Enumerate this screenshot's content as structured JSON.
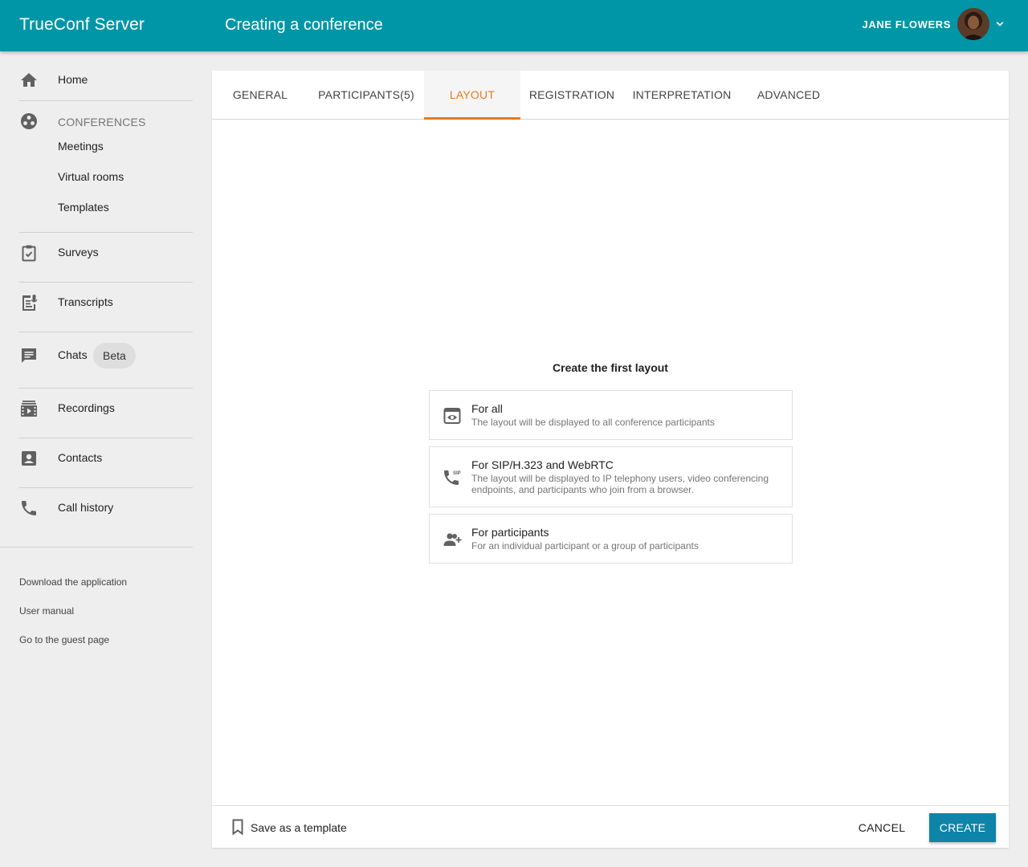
{
  "header": {
    "brand": "TrueConf Server",
    "title": "Creating a conference",
    "user_name": "JANE FLOWERS",
    "avatar_icon": "user-avatar",
    "menu_icon": "chevron-down-icon"
  },
  "sidebar": {
    "home": {
      "label": "Home",
      "icon": "home-icon"
    },
    "conferences": {
      "title": "CONFERENCES",
      "icon": "conferences-icon",
      "items": [
        "Meetings",
        "Virtual rooms",
        "Templates"
      ]
    },
    "surveys": {
      "label": "Surveys",
      "icon": "clipboard-check-icon"
    },
    "transcripts": {
      "label": "Transcripts",
      "icon": "transcript-icon"
    },
    "chats": {
      "label": "Chats",
      "badge": "Beta",
      "icon": "chat-icon"
    },
    "recordings": {
      "label": "Recordings",
      "icon": "recordings-icon"
    },
    "contacts": {
      "label": "Contacts",
      "icon": "contact-icon"
    },
    "call_history": {
      "label": "Call history",
      "icon": "phone-icon"
    },
    "footer_links": [
      "Download the application",
      "User manual",
      "Go to the guest page"
    ]
  },
  "tabs": [
    {
      "label": "GENERAL",
      "active": false
    },
    {
      "label": "PARTICIPANTS(5)",
      "active": false
    },
    {
      "label": "LAYOUT",
      "active": true
    },
    {
      "label": "REGISTRATION",
      "active": false
    },
    {
      "label": "INTERPRETATION",
      "active": false
    },
    {
      "label": "ADVANCED",
      "active": false
    }
  ],
  "layout": {
    "empty_title": "Create the first layout",
    "options": [
      {
        "title": "For all",
        "description": "The layout will be displayed to all conference participants",
        "icon": "eye-window-icon"
      },
      {
        "title": "For SIP/H.323 and WebRTC",
        "description": "The layout will be displayed to IP telephony users, video conferencing endpoints, and participants who join from a browser.",
        "icon": "sip-phone-icon"
      },
      {
        "title": "For participants",
        "description": "For an individual participant or a group of participants",
        "icon": "add-participants-icon"
      }
    ]
  },
  "footer": {
    "save_template": "Save as a template",
    "cancel": "CANCEL",
    "create": "CREATE"
  },
  "colors": {
    "header": "#0096a7",
    "active_tab": "#e87a1d",
    "primary_button": "#0d84a8"
  }
}
